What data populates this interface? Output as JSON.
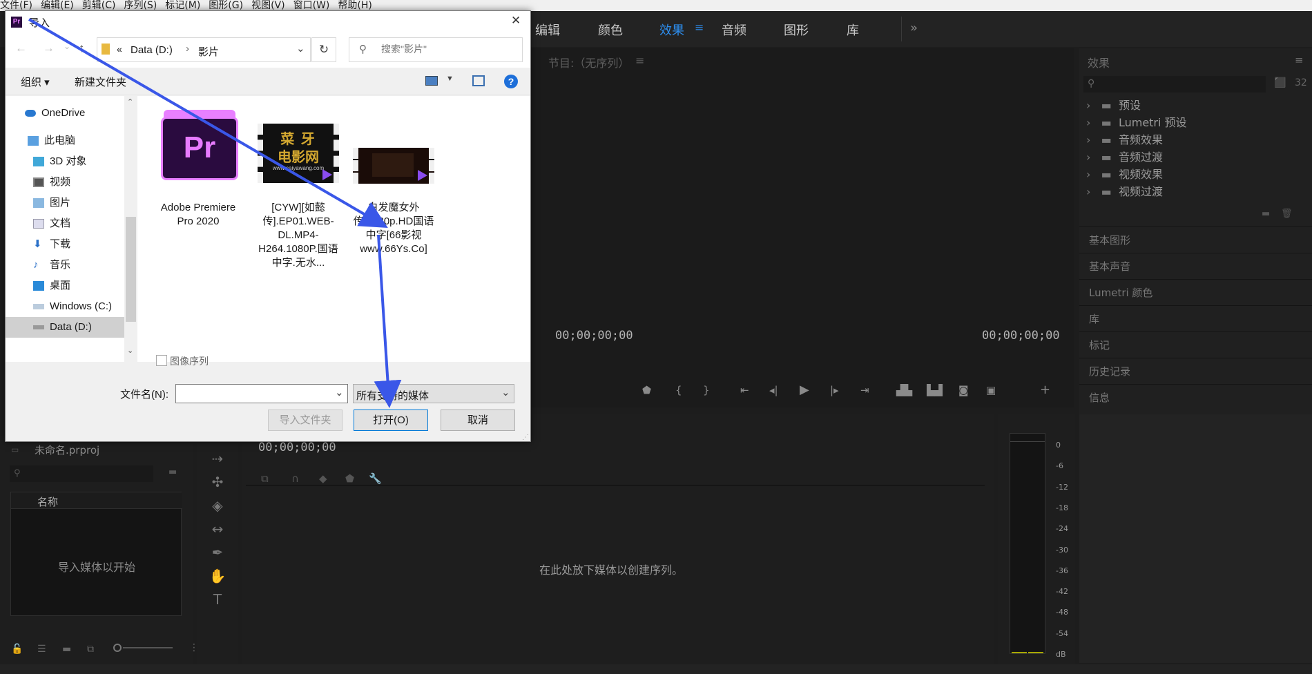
{
  "menu": [
    "文件(F)",
    "编辑(E)",
    "剪辑(C)",
    "序列(S)",
    "标记(M)",
    "图形(G)",
    "视图(V)",
    "窗口(W)",
    "帮助(H)"
  ],
  "workspace_tabs": [
    "编辑",
    "颜色",
    "效果",
    "音频",
    "图形",
    "库"
  ],
  "workspace_more": "»",
  "workspace_active_menu": "≡",
  "program": {
    "title": "节目:（无序列）",
    "menu": "≡",
    "tc_left": "00;00;00;00",
    "tc_right": "00;00;00;00"
  },
  "effects": {
    "title": "效果",
    "menu": "≡",
    "items": [
      "预设",
      "Lumetri 预设",
      "音频效果",
      "音频过渡",
      "视频效果",
      "视频过渡"
    ],
    "sections": [
      "基本图形",
      "基本声音",
      "Lumetri 颜色",
      "库",
      "标记",
      "历史记录",
      "信息"
    ]
  },
  "project": {
    "name": "未命名.prproj",
    "column": "名称",
    "empty": "导入媒体以开始"
  },
  "timeline": {
    "tc": "00;00;00;00",
    "empty": "在此处放下媒体以创建序列。"
  },
  "meter": {
    "labels": [
      "0",
      "-6",
      "-12",
      "-18",
      "-24",
      "-30",
      "-36",
      "-42",
      "-48",
      "-54",
      "dB"
    ]
  },
  "dialog": {
    "title": "导入",
    "pr_badge": "Pr",
    "close": "✕",
    "breadcrumb": {
      "sep": "«",
      "drive": "Data (D:)",
      "arrow": "›",
      "folder": "影片"
    },
    "search_placeholder": "搜索\"影片\"",
    "organize": "组织 ▾",
    "new_folder": "新建文件夹",
    "help": "?",
    "nav": [
      "OneDrive",
      "此电脑",
      "3D 对象",
      "视频",
      "图片",
      "文档",
      "下载",
      "音乐",
      "桌面",
      "Windows (C:)",
      "Data (D:)"
    ],
    "files": [
      {
        "label": "Adobe Premiere Pro 2020",
        "thumb": "Pr"
      },
      {
        "label": "[CYW][如懿传].EP01.WEB-DL.MP4-H264.1080P.国语中字.无水...",
        "thumb_line1": "菜 牙",
        "thumb_line2": "电影网",
        "thumb_url": "www.caiyawang.com"
      },
      {
        "label": "白发魔女外传.1080p.HD国语中字[66影视www.66Ys.Co]"
      }
    ],
    "image_sequence": "图像序列",
    "filename_label": "文件名(N):",
    "filename_value": "",
    "filetype": "所有支持的媒体",
    "btn_import_folder": "导入文件夹",
    "btn_open": "打开(O)",
    "btn_cancel": "取消"
  },
  "colors": {
    "accent": "#2d8ceb",
    "arrow": "#3a57e8",
    "pr_purple": "#2a0b3f",
    "pr_text": "#e77bff"
  }
}
